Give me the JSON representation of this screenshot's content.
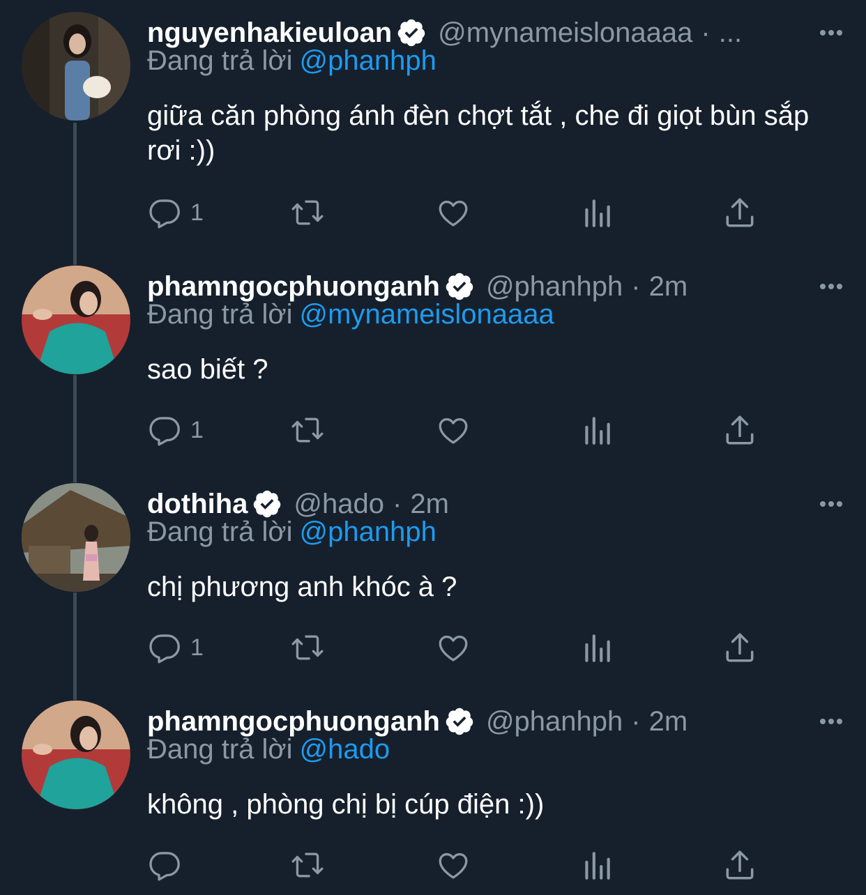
{
  "colors": {
    "background": "#16202c",
    "muted": "#8b98a5",
    "link": "#1d9bf0",
    "thread_line": "#3d4a57"
  },
  "reply_prefix": "Đang trả lời",
  "icons": [
    "reply-icon",
    "retweet-icon",
    "like-icon",
    "analytics-icon",
    "share-icon",
    "verified-icon",
    "more-icon"
  ],
  "tweets": [
    {
      "name": "nguyenhakieuloan",
      "handle": "@mynameislonaaaa",
      "separator": "·",
      "time": "...",
      "reply_to": "@phanhph",
      "text": "giữa căn phòng ánh đèn chợt tắt , che đi giọt bùn sắp rơi :))",
      "reply_count": "1"
    },
    {
      "name": "phamngocphuonganh",
      "handle": "@phanhph",
      "separator": "·",
      "time": "2m",
      "reply_to": "@mynameislonaaaa",
      "text": "sao biết ?",
      "reply_count": "1"
    },
    {
      "name": "dothiha",
      "handle": "@hado",
      "separator": "·",
      "time": "2m",
      "reply_to": "@phanhph",
      "text": "chị phương anh khóc à ?",
      "reply_count": "1"
    },
    {
      "name": "phamngocphuonganh",
      "handle": "@phanhph",
      "separator": "·",
      "time": "2m",
      "reply_to": "@hado",
      "text": "không , phòng chị bị cúp điện :))",
      "reply_count": ""
    }
  ]
}
